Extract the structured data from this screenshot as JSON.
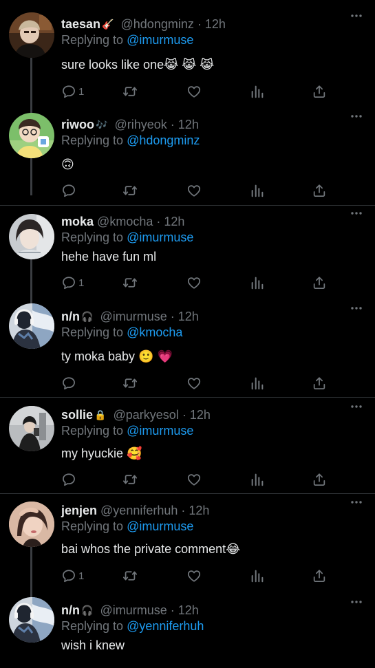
{
  "colors": {
    "background": "#000000",
    "text": "#e7e9ea",
    "secondary": "#71767b",
    "link": "#1d9bf0",
    "divider": "#2f3336"
  },
  "tweets": [
    {
      "name": "taesan",
      "badge": "🎸",
      "handle": "@hdongminz",
      "dot": "·",
      "time": "12h",
      "replying_prefix": "Replying to",
      "replying_to": "@imurmuse",
      "text": "sure looks like one😹 😹 😹",
      "reply_count": "1",
      "icons": [
        "reply-icon",
        "retweet-icon",
        "like-icon",
        "analytics-icon",
        "share-icon",
        "more-icon"
      ]
    },
    {
      "name": "riwoo",
      "badge": "🎶",
      "handle": "@rihyeok",
      "dot": "·",
      "time": "12h",
      "replying_prefix": "Replying to",
      "replying_to": "@hdongminz",
      "text": "🙃",
      "reply_count": ""
    },
    {
      "name": "moka",
      "badge": "",
      "handle": "@kmocha",
      "dot": "·",
      "time": "12h",
      "replying_prefix": "Replying to",
      "replying_to": "@imurmuse",
      "text": "hehe have fun ml",
      "reply_count": "1"
    },
    {
      "name": "n/n",
      "badge": "🎧",
      "handle": "@imurmuse",
      "dot": "·",
      "time": "12h",
      "replying_prefix": "Replying to",
      "replying_to": "@kmocha",
      "text": "ty moka baby 🙂 💗",
      "reply_count": ""
    },
    {
      "name": "sollie",
      "badge": "🔒",
      "handle": "@parkyesol",
      "dot": "·",
      "time": "12h",
      "replying_prefix": "Replying to",
      "replying_to": "@imurmuse",
      "text": "my hyuckie 🥰",
      "reply_count": ""
    },
    {
      "name": "jenjen",
      "badge": "",
      "handle": "@yenniferhuh",
      "dot": "·",
      "time": "12h",
      "replying_prefix": "Replying to",
      "replying_to": "@imurmuse",
      "text": "bai whos the private comment😂",
      "reply_count": "1"
    },
    {
      "name": "n/n",
      "badge": "🎧",
      "handle": "@imurmuse",
      "dot": "·",
      "time": "12h",
      "replying_prefix": "Replying to",
      "replying_to": "@yenniferhuh",
      "text": "wish i knew",
      "reply_count": ""
    }
  ]
}
